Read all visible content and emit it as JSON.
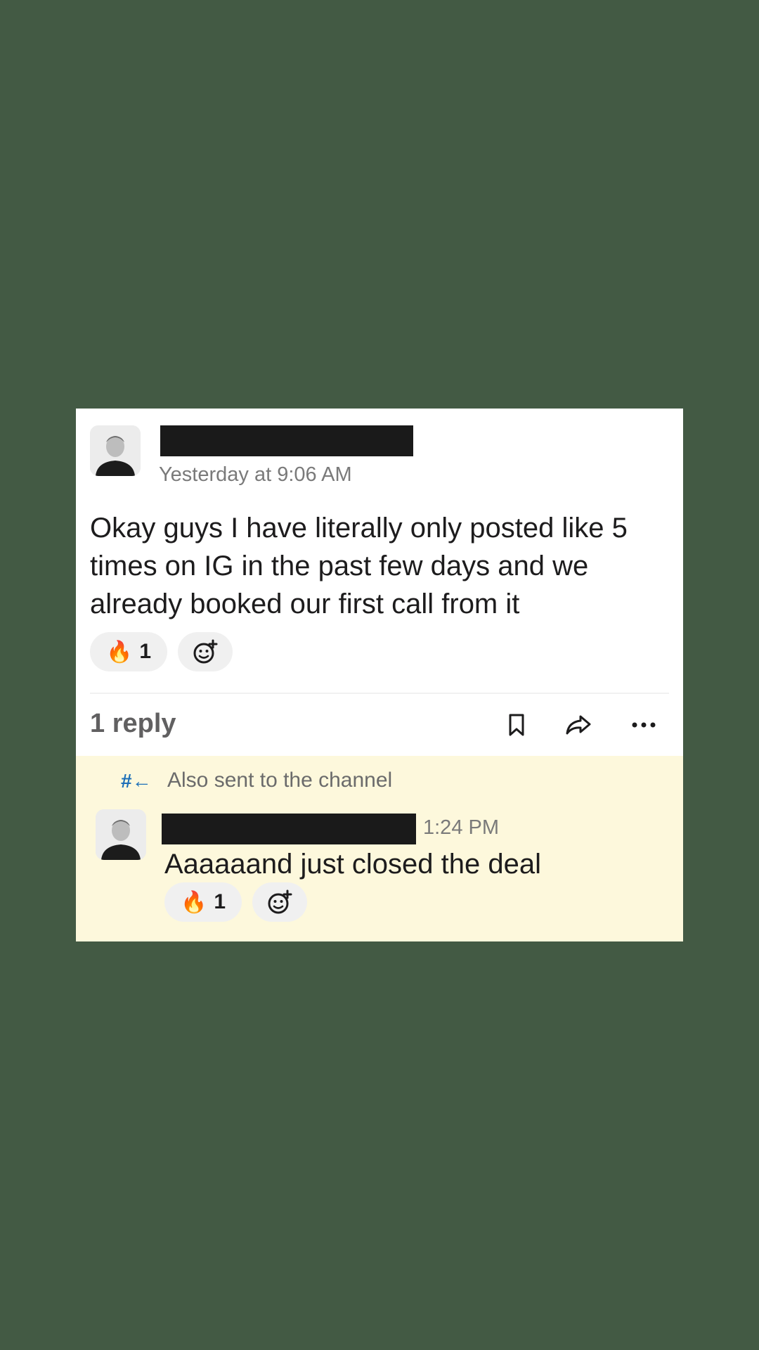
{
  "post": {
    "timestamp": "Yesterday at 9:06 AM",
    "message": "Okay guys I have literally only posted like 5 times on IG in the past few days and we already booked our first call from it",
    "reaction_emoji": "🔥",
    "reaction_count": "1",
    "reply_count": "1 reply"
  },
  "actions": {
    "save_icon": "bookmark-icon",
    "share_icon": "share-arrow-icon",
    "more_icon": "more-horizontal-icon",
    "more_glyph": "···"
  },
  "thread_reply": {
    "channel_glyph": "#←",
    "also_sent": "Also sent to the channel",
    "timestamp": "1:24 PM",
    "message": "Aaaaaand just closed the deal",
    "reaction_emoji": "🔥",
    "reaction_count": "1"
  },
  "colors": {
    "page_background": "#435a44",
    "card_background": "#ffffff",
    "thread_highlight": "#fdf8dc",
    "redaction": "#1a1a1a",
    "channel_link": "#1d6fb8"
  }
}
